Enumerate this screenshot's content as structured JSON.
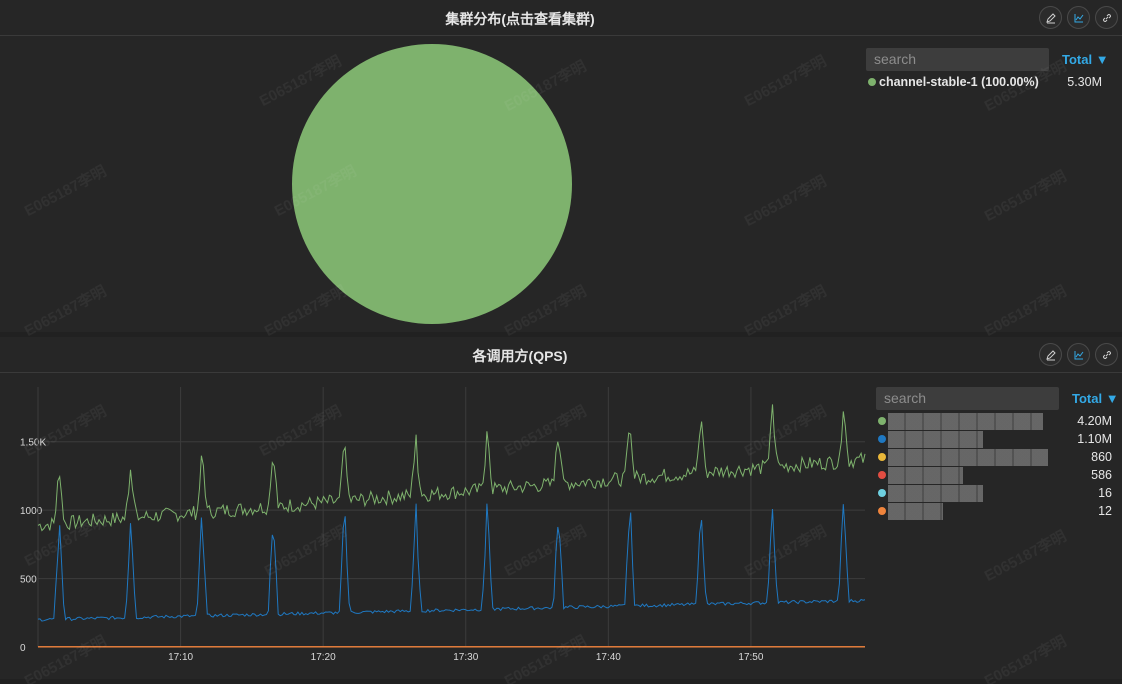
{
  "panels": {
    "cluster": {
      "title": "集群分布(点击查看集群)",
      "search_placeholder": "search",
      "total_label": "Total ▼",
      "legend": [
        {
          "label": "channel-stable-1 (100.00%)",
          "value": "5.30M",
          "color": "#7eb26d"
        }
      ]
    },
    "qps": {
      "title": "各调用方(QPS)",
      "search_placeholder": "search",
      "total_label": "Total ▼",
      "legend": [
        {
          "value": "4.20M",
          "color": "#7eb26d"
        },
        {
          "value": "1.10M",
          "color": "#1f78c1"
        },
        {
          "value": "860",
          "color": "#eab839"
        },
        {
          "value": "586",
          "color": "#e24d42"
        },
        {
          "value": "16",
          "color": "#6ed0e0"
        },
        {
          "value": "12",
          "color": "#ef843c"
        }
      ]
    }
  },
  "icons": [
    "edit-icon",
    "graph-icon",
    "link-icon"
  ],
  "watermark": "E065187李明",
  "chart_data": [
    {
      "type": "pie",
      "title": "集群分布(点击查看集群)",
      "slices": [
        {
          "name": "channel-stable-1",
          "value": 5300000,
          "percent": 100.0,
          "color": "#7eb26d"
        }
      ]
    },
    {
      "type": "line",
      "title": "各调用方(QPS)",
      "x_ticks": [
        "17:10",
        "17:20",
        "17:30",
        "17:40",
        "17:50"
      ],
      "y_ticks": [
        "0",
        "500",
        "1000",
        "1.50K"
      ],
      "ylim": [
        0,
        1900
      ],
      "xlim_minutes": [
        0,
        58
      ],
      "grid": true,
      "legend_placement": "right",
      "series": [
        {
          "color": "#7eb26d",
          "baseline_start": 890,
          "baseline_end": 1370,
          "spike_height": 420,
          "spikes_at_minute": [
            1.5,
            6.5,
            11.5,
            16.5,
            21.5,
            26.5,
            31.5,
            36.5,
            41.5,
            46.5,
            51.5,
            56.5
          ]
        },
        {
          "color": "#1f78c1",
          "baseline_start": 200,
          "baseline_end": 340,
          "spike_height": 780,
          "spikes_at_minute": [
            1.5,
            6.5,
            11.5,
            16.5,
            21.5,
            26.5,
            31.5,
            36.5,
            41.5,
            46.5,
            51.5,
            56.5
          ]
        },
        {
          "color": "#eab839",
          "constant": 3
        },
        {
          "color": "#e24d42",
          "constant": 2
        },
        {
          "color": "#6ed0e0",
          "constant": 0
        },
        {
          "color": "#ef843c",
          "constant": 0
        }
      ]
    }
  ]
}
